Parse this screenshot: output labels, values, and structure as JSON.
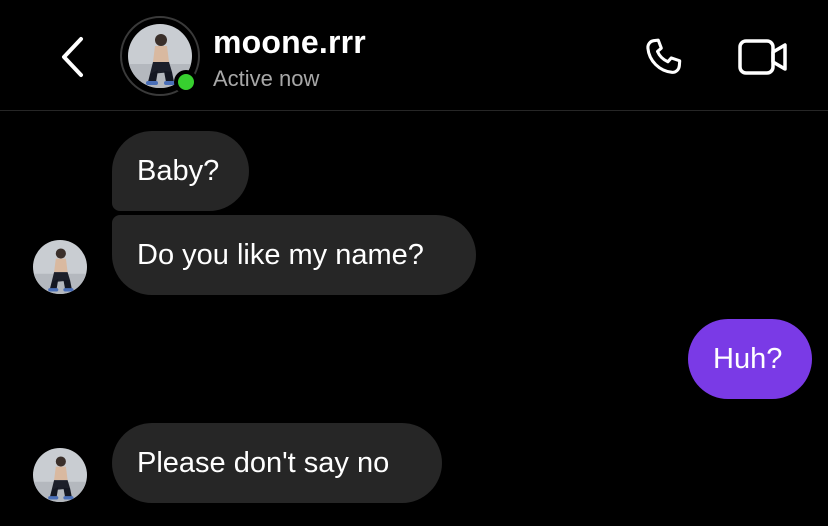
{
  "header": {
    "username": "moone.rrr",
    "status": "Active now",
    "back_icon": "chevron-left-icon",
    "call_icon": "phone-icon",
    "video_icon": "video-camera-icon",
    "online_color": "#37d02f"
  },
  "messages": [
    {
      "from": "them",
      "text": "Baby?"
    },
    {
      "from": "them",
      "text": "Do you like my name?"
    },
    {
      "from": "me",
      "text": "Huh?"
    },
    {
      "from": "them",
      "text": "Please don't say no"
    }
  ],
  "colors": {
    "background": "#000000",
    "received_bubble": "#262626",
    "sent_bubble": "#7a3ae6",
    "secondary_text": "#a8a8a8"
  }
}
